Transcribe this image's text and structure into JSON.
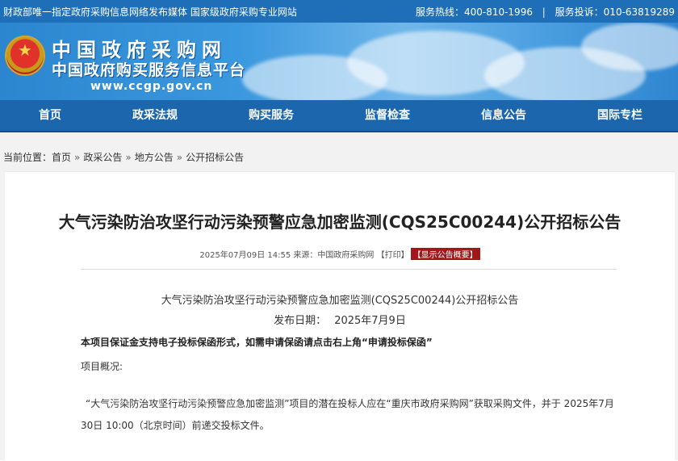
{
  "topbar": {
    "left_text": "财政部唯一指定政府采购信息网络发布媒体 国家级政府采购专业网站",
    "hotline": "服务热线：400-810-1996",
    "separator": "|",
    "complaint": "服务投诉：010-63819289"
  },
  "banner": {
    "title": "中国政府采购网",
    "subtitle": "中国政府购买服务信息平台",
    "url": "www.ccgp.gov.cn",
    "emblem_icon": "national-emblem-icon"
  },
  "nav": {
    "items": [
      {
        "label": "首页"
      },
      {
        "label": "政采法规"
      },
      {
        "label": "购买服务"
      },
      {
        "label": "监督检查"
      },
      {
        "label": "信息公告"
      },
      {
        "label": "国际专栏"
      }
    ]
  },
  "breadcrumb": {
    "prefix": "当前位置：",
    "items": [
      "首页",
      "政采公告",
      "地方公告",
      "公开招标公告"
    ],
    "arrow": "»"
  },
  "article": {
    "title": "大气污染防治攻坚行动污染预警应急加密监测(CQS25C00244)公开招标公告",
    "meta_text": "2025年07月09日 14:55 来源：中国政府采购网 ",
    "print_label": "【打印】",
    "summary_label": "【显示公告概要】",
    "doc_heading": "大气污染防治攻坚行动污染预警应急加密监测(CQS25C00244)公开招标公告",
    "date_label": "发布日期：",
    "date_value": "2025年7月9日",
    "notice": "本项目保证金支持电子投标保函形式，如需申请保函请点击右上角“申请投标保函”",
    "overview_label": "项目概况:",
    "paragraph": "“大气污染防治攻坚行动污染预警应急加密监测”项目的潜在投标人应在“重庆市政府采购网”获取采购文件，并于 2025年7月30日 10:00（北京时间）前递交投标文件。"
  },
  "colors": {
    "topbar": "#1f6fb8",
    "nav": "#1b66ad",
    "summary_button": "#a3161a"
  }
}
